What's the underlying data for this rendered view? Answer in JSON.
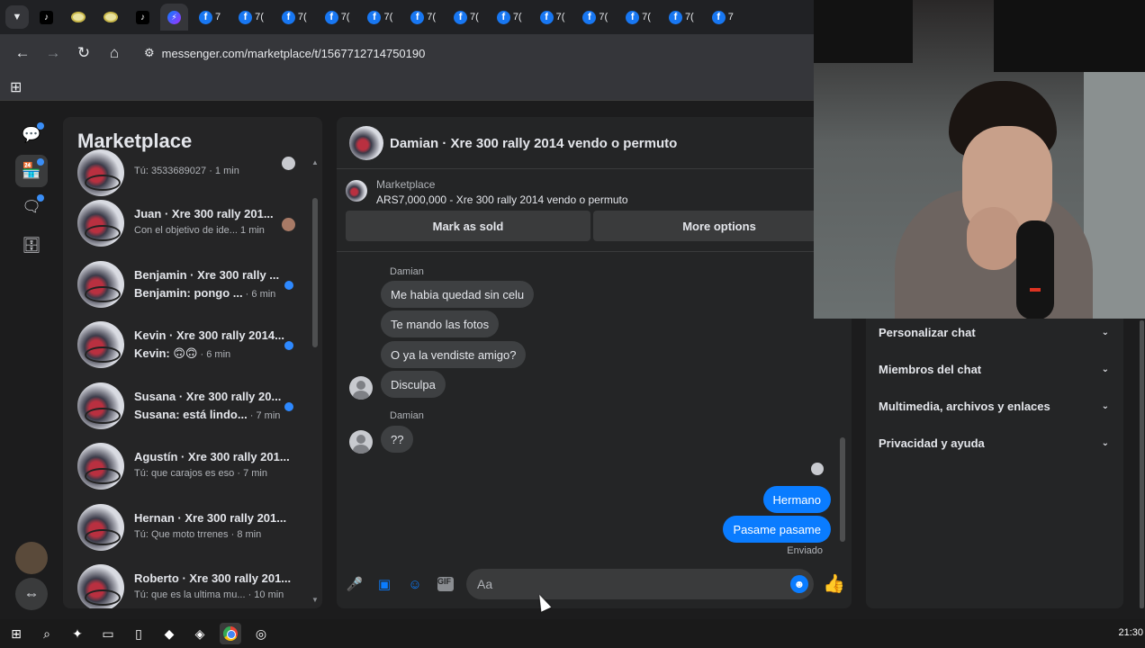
{
  "browser": {
    "tabs": [
      {
        "type": "tiktok",
        "label": ""
      },
      {
        "type": "cursor",
        "label": ""
      },
      {
        "type": "cursor",
        "label": ""
      },
      {
        "type": "tiktok",
        "label": ""
      },
      {
        "type": "messenger",
        "label": "",
        "active": true
      },
      {
        "type": "facebook",
        "label": "7"
      },
      {
        "type": "facebook",
        "label": "7("
      },
      {
        "type": "facebook",
        "label": "7("
      },
      {
        "type": "facebook",
        "label": "7("
      },
      {
        "type": "facebook",
        "label": "7("
      },
      {
        "type": "facebook",
        "label": "7("
      },
      {
        "type": "facebook",
        "label": "7("
      },
      {
        "type": "facebook",
        "label": "7("
      },
      {
        "type": "facebook",
        "label": "7("
      },
      {
        "type": "facebook",
        "label": "7("
      },
      {
        "type": "facebook",
        "label": "7("
      },
      {
        "type": "facebook",
        "label": "7("
      },
      {
        "type": "facebook",
        "label": "7"
      }
    ],
    "url": "messenger.com/marketplace/t/1567712714750190"
  },
  "sidebar": {
    "title": "Marketplace",
    "conversations": [
      {
        "name": "",
        "preview": "Tú: 3533689027",
        "time": "· 1 min",
        "unread": false,
        "status": "seen"
      },
      {
        "name": "Juan · Xre 300 rally 201...",
        "preview": "Con el objetivo de ide...",
        "time": "1 min",
        "unread": false,
        "status": "face"
      },
      {
        "name": "Benjamin · Xre 300 rally ...",
        "preview": "Benjamin: pongo ...",
        "time": "· 6 min",
        "unread": true,
        "status": "dot"
      },
      {
        "name": "Kevin · Xre 300 rally 2014...",
        "preview": "Kevin: 🙃🙃",
        "time": "· 6 min",
        "unread": true,
        "status": "dot"
      },
      {
        "name": "Susana · Xre 300 rally 20...",
        "preview": "Susana: está lindo...",
        "time": "· 7 min",
        "unread": true,
        "status": "dot"
      },
      {
        "name": "Agustín · Xre 300 rally 201...",
        "preview": "Tú: que carajos es eso",
        "time": "· 7 min",
        "unread": false,
        "status": ""
      },
      {
        "name": "Hernan · Xre 300 rally 201...",
        "preview": "Tú: Que moto trrenes",
        "time": "· 8 min",
        "unread": false,
        "status": ""
      },
      {
        "name": "Roberto · Xre 300 rally 201...",
        "preview": "Tú: que es la ultima mu...",
        "time": "· 10 min",
        "unread": false,
        "status": ""
      }
    ]
  },
  "chat": {
    "title": "Damian · Xre 300 rally 2014 vendo o permuto",
    "marketplace_label": "Marketplace",
    "listing": "ARS7,000,000 - Xre 300 rally 2014 vendo o permuto",
    "mark_sold": "Mark as sold",
    "more_options": "More options",
    "sender_name": "Damian",
    "messages_in": [
      "Me habia quedad sin celu",
      "Te mando las fotos",
      "O ya la vendiste amigo?",
      "Disculpa"
    ],
    "message_in_2": "??",
    "messages_out": [
      "Hermano",
      "Pasame pasame"
    ],
    "sent_status": "Enviado",
    "input_placeholder": "Aa"
  },
  "info_panel": {
    "items": [
      "Personalizar chat",
      "Miembros del chat",
      "Multimedia, archivos y enlaces",
      "Privacidad y ayuda"
    ]
  },
  "taskbar": {
    "clock": "21:30"
  },
  "colors": {
    "accent": "#0a7cff",
    "background": "#1c1c1d",
    "panel": "#242526"
  }
}
